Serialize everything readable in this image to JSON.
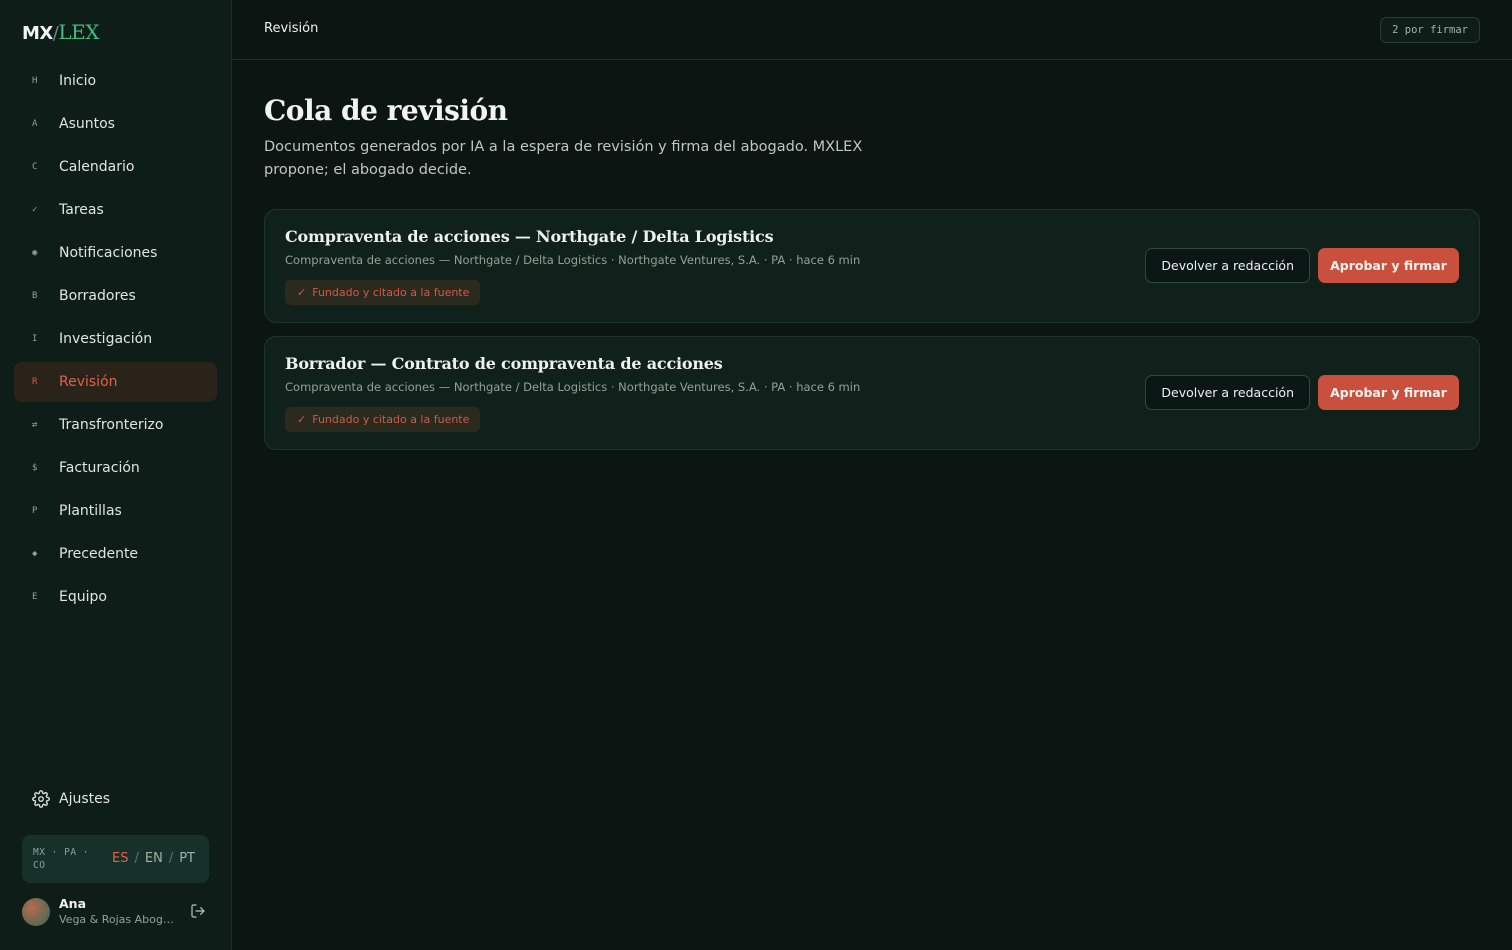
{
  "logo": {
    "mx": "MX",
    "slash": "/",
    "lex": "LEX"
  },
  "sidebar": {
    "items": [
      {
        "key": "H",
        "label": "Inicio"
      },
      {
        "key": "A",
        "label": "Asuntos"
      },
      {
        "key": "C",
        "label": "Calendario"
      },
      {
        "key": "✓",
        "label": "Tareas"
      },
      {
        "key": "◉",
        "label": "Notificaciones"
      },
      {
        "key": "B",
        "label": "Borradores"
      },
      {
        "key": "I",
        "label": "Investigación"
      },
      {
        "key": "R",
        "label": "Revisión",
        "active": true
      },
      {
        "key": "⇄",
        "label": "Transfronterizo"
      },
      {
        "key": "$",
        "label": "Facturación"
      },
      {
        "key": "P",
        "label": "Plantillas"
      },
      {
        "key": "◆",
        "label": "Precedente"
      },
      {
        "key": "E",
        "label": "Equipo"
      }
    ],
    "settings_label": "Ajustes",
    "regions": "MX · PA · CO",
    "languages": {
      "es": "ES",
      "en": "EN",
      "pt": "PT",
      "sep": "/"
    },
    "user": {
      "name": "Ana",
      "org": "Vega & Rojas Abogados"
    }
  },
  "topbar": {
    "breadcrumb": "Revisión",
    "pending": "2 por firmar"
  },
  "main": {
    "title": "Cola de revisión",
    "subtitle": "Documentos generados por IA a la espera de revisión y firma del abogado. MXLEX propone; el abogado decide.",
    "cards": [
      {
        "title": "Compraventa de acciones — Northgate / Delta Logistics",
        "meta": "Compraventa de acciones — Northgate / Delta Logistics · Northgate Ventures, S.A. · PA · hace 6 min",
        "badge": "Fundado y citado a la fuente",
        "return_label": "Devolver a redacción",
        "approve_label": "Aprobar y firmar"
      },
      {
        "title": "Borrador — Contrato de compraventa de acciones",
        "meta": "Compraventa de acciones — Northgate / Delta Logistics · Northgate Ventures, S.A. · PA · hace 6 min",
        "badge": "Fundado y citado a la fuente",
        "return_label": "Devolver a redacción",
        "approve_label": "Aprobar y firmar"
      }
    ]
  },
  "colors": {
    "accent": "#c9503d",
    "brand_green": "#3fbf7f",
    "background": "#0b1512",
    "sidebar": "#0f1d19"
  }
}
